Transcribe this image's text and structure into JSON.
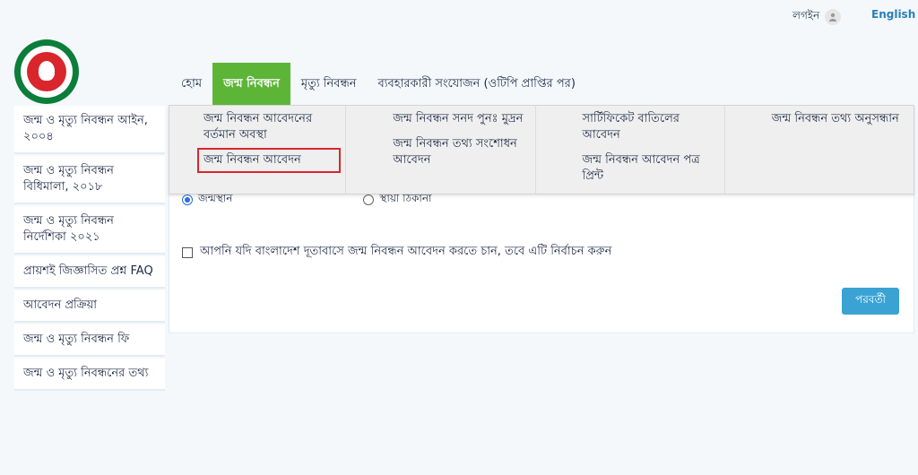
{
  "header": {
    "login_label": "লগইন",
    "language_label": "English"
  },
  "nav": {
    "items": [
      {
        "label": "হোম"
      },
      {
        "label": "জন্ম নিবন্ধন"
      },
      {
        "label": "মৃত্যু নিবন্ধন"
      },
      {
        "label": "ব্যবহারকারী সংযোজন (ওটিপি প্রাপ্তির পর)"
      }
    ]
  },
  "dropdown": {
    "columns": [
      [
        "জন্ম নিবন্ধন আবেদনের বর্তমান অবস্থা",
        "জন্ম নিবন্ধন আবেদন"
      ],
      [
        "জন্ম নিবন্ধন সনদ পুনঃ মুদ্রন",
        "জন্ম নিবন্ধন তথ্য সংশোধন আবেদন"
      ],
      [
        "সার্টিফিকেট বাতিলের আবেদন",
        "জন্ম নিবন্ধন আবেদন পত্র প্রিন্ট"
      ],
      [
        "জন্ম নিবন্ধন তথ্য অনুসন্ধান"
      ]
    ]
  },
  "sidebar": {
    "items": [
      "জন্ম ও মৃত্যু নিবন্ধন আইন, ২০০৪",
      "জন্ম ও মৃত্যু নিবন্ধন বিধিমালা, ২০১৮",
      "জন্ম ও মৃত্যু নিবন্ধন নির্দেশিকা ২০২১",
      "প্রায়শই জিজ্ঞাসিত প্রশ্ন FAQ",
      "আবেদন প্রক্রিয়া",
      "জন্ম ও মৃত্যু নিবন্ধন ফি",
      "জন্ম ও মৃত্যু নিবন্ধনের তথ্য"
    ]
  },
  "form": {
    "radio_birthplace": "জন্মস্থান",
    "radio_permanent": "স্থায়ী ঠিকানা",
    "embassy_checkbox_label": "আপনি যদি বাংলাদেশ দূতাবাসে জন্ম নিবন্ধন আবেদন করতে চান, তবে এটি নির্বাচন করুন",
    "next_button": "পরবর্তী"
  },
  "colors": {
    "nav_active": "#5db537",
    "button": "#3aa3d4",
    "highlight": "#d9262c"
  }
}
